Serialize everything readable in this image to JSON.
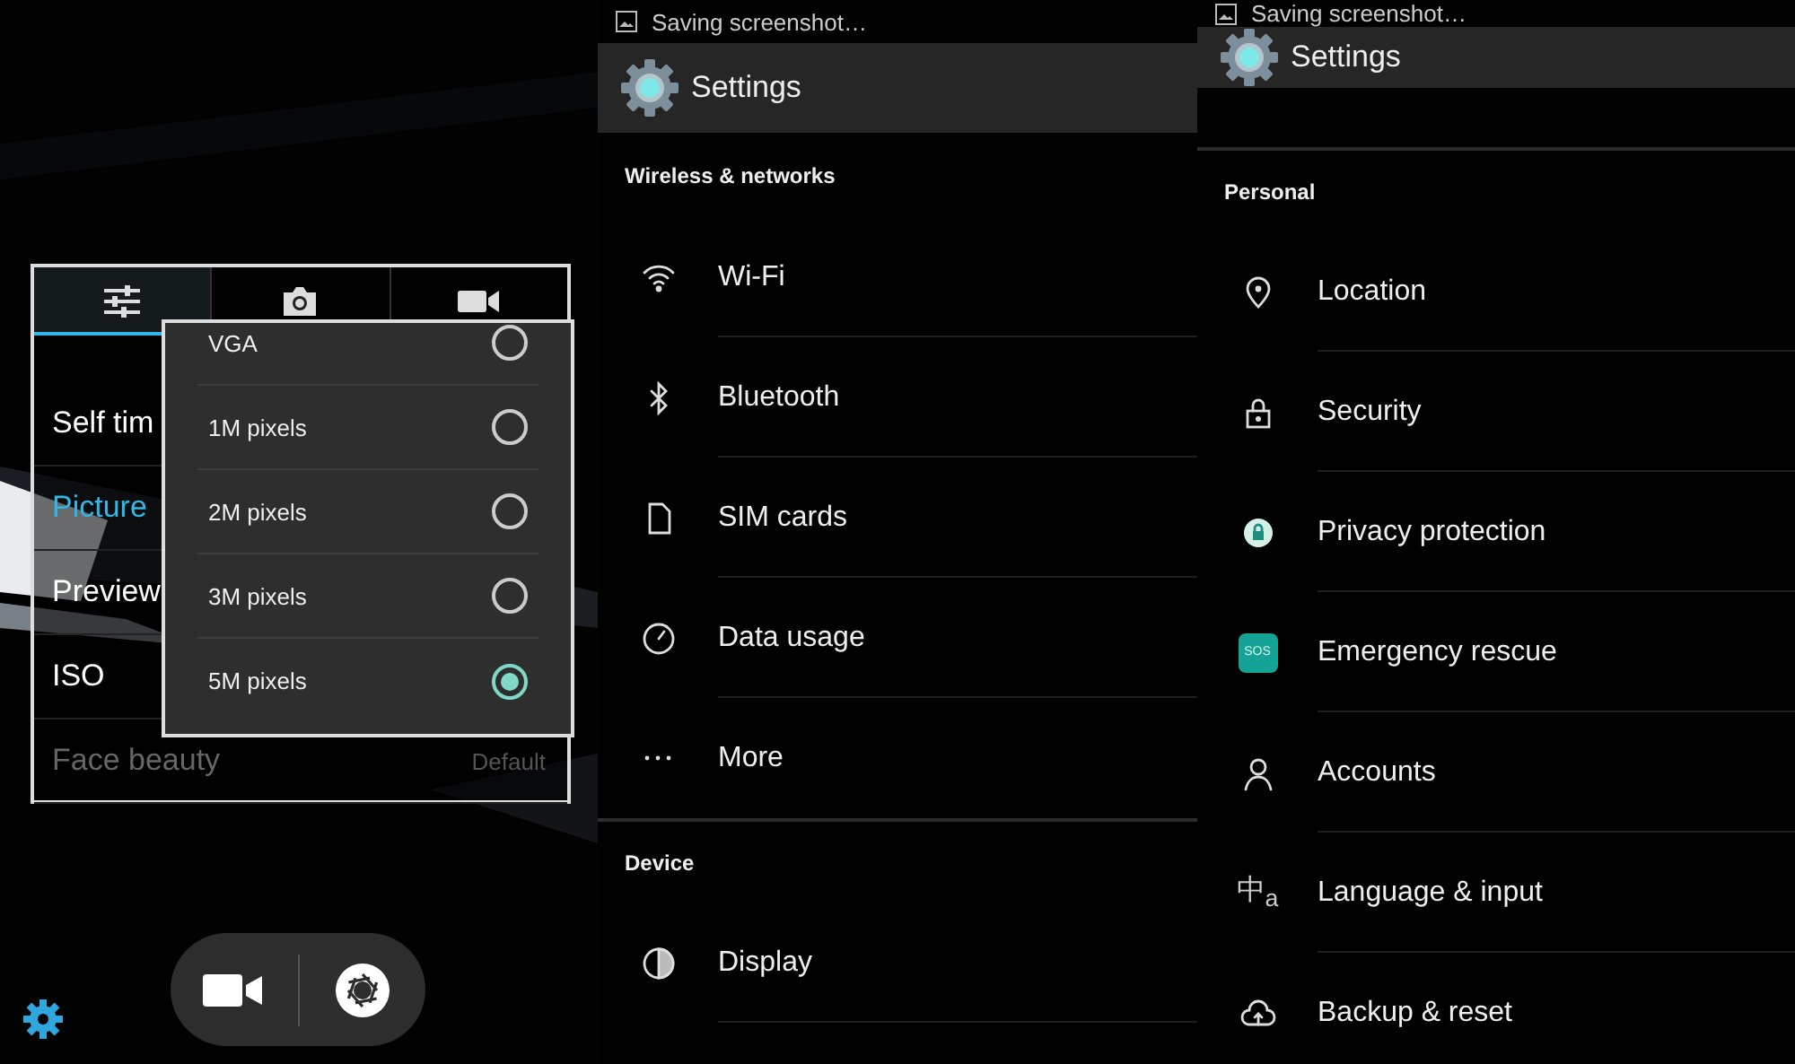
{
  "camera": {
    "tabs": [
      {
        "selected": true
      },
      {
        "selected": false
      },
      {
        "selected": false
      }
    ],
    "settings": [
      {
        "label": "Self tim",
        "selected": false,
        "disabled": false
      },
      {
        "label": "Picture",
        "selected": true,
        "disabled": false
      },
      {
        "label": "Preview",
        "selected": false,
        "disabled": false
      },
      {
        "label": "ISO",
        "selected": false,
        "disabled": false
      },
      {
        "label": "Face beauty",
        "value": "Default",
        "selected": false,
        "disabled": true
      }
    ],
    "picture_size_options": [
      {
        "label": "VGA",
        "selected": false
      },
      {
        "label": "1M pixels",
        "selected": false
      },
      {
        "label": "2M pixels",
        "selected": false
      },
      {
        "label": "3M pixels",
        "selected": false
      },
      {
        "label": "5M pixels",
        "selected": true
      }
    ]
  },
  "settings_screens": [
    {
      "status": "Saving screenshot…",
      "title": "Settings",
      "rows": [
        {
          "kind": "header",
          "label": "Wireless & networks"
        },
        {
          "kind": "item",
          "label": "Wi-Fi"
        },
        {
          "kind": "item",
          "label": "Bluetooth"
        },
        {
          "kind": "item",
          "label": "SIM cards"
        },
        {
          "kind": "item",
          "label": "Data usage"
        },
        {
          "kind": "item",
          "label": "More"
        },
        {
          "kind": "header",
          "label": "Device"
        },
        {
          "kind": "item",
          "label": "Display"
        }
      ]
    },
    {
      "status": "Saving screenshot…",
      "title": "Settings",
      "rows": [
        {
          "kind": "header",
          "label": "Personal"
        },
        {
          "kind": "item",
          "label": "Location"
        },
        {
          "kind": "item",
          "label": "Security"
        },
        {
          "kind": "item",
          "label": "Privacy protection"
        },
        {
          "kind": "item",
          "label": "Emergency rescue",
          "badge": "SOS"
        },
        {
          "kind": "item",
          "label": "Accounts"
        },
        {
          "kind": "item",
          "label": "Language & input",
          "badge": "中$_{a}$"
        },
        {
          "kind": "item",
          "label": "Backup & reset"
        }
      ]
    }
  ]
}
